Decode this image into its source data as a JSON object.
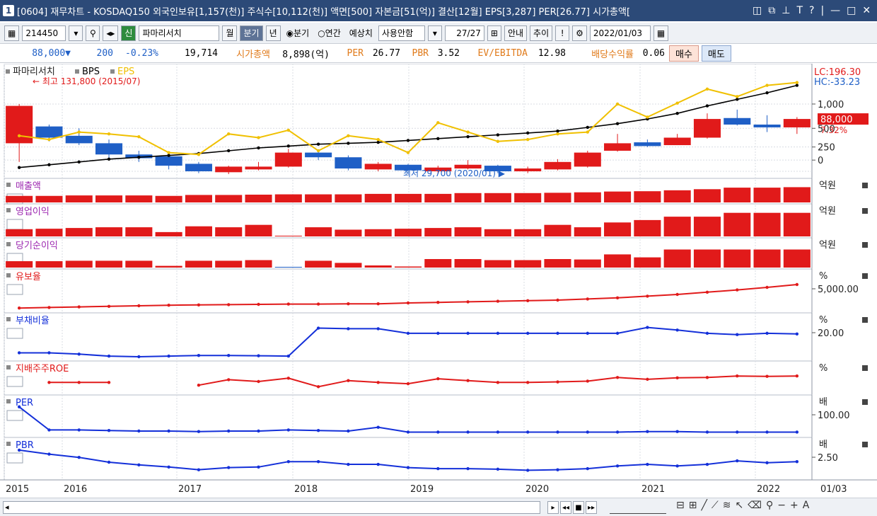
{
  "window": {
    "num": "1",
    "title": "[0604] 재무차트 - KOSDAQ150 외국인보유[1,157(천)] 주식수[10,112(천)] 액면[500] 자본금[51(억)] 결산[12월] EPS[3,287] PER[26.77] 시가총액[",
    "icons": [
      "◫",
      "⧉",
      "⊥",
      "T",
      "?",
      "|",
      "—",
      "□",
      "✕"
    ]
  },
  "toolbar": {
    "code": "214450",
    "mode": "신",
    "name": "파마리서치",
    "period_month": "월",
    "period_quarter": "분기",
    "period_year": "년",
    "radio_quarter": "◉분기",
    "radio_annual": "○연간",
    "estimate_label": "예상치",
    "estimate_value": "사용안함",
    "page": "27/27",
    "guide": "안내",
    "trend": "추이",
    "excl": "!",
    "date": "2022/01/03"
  },
  "info": {
    "price": "88,000▼",
    "change": "200",
    "change_pct": "-0.23%",
    "volume": "19,714",
    "mcap_label": "시가총액",
    "mcap": "8,898(억)",
    "per_label": "PER",
    "per": "26.77",
    "pbr_label": "PBR",
    "pbr": "3.52",
    "ev_label": "EV/EBITDA",
    "ev": "12.98",
    "div_label": "배당수익률",
    "div": "0.06",
    "buy": "매수",
    "sell": "매도"
  },
  "colors": {
    "up": "#e11a1a",
    "down": "#1f5fc6",
    "eps": "#f0c000",
    "bps": "#000000",
    "grid": "#d8dce3",
    "axis_bg": "#ffffff"
  },
  "chart_data": {
    "type": "candlestick+lines+bars",
    "x_labels": [
      "2015",
      "2016",
      "2017",
      "2018",
      "2019",
      "2020",
      "2021",
      "2022",
      "01/03"
    ],
    "main": {
      "legend": [
        "파마리서치",
        "BPS",
        "EPS"
      ],
      "high_note": "최고 131,800 (2015/07)",
      "low_note": "최저 29,700 (2020/01)",
      "lc": "LC:196.30",
      "hc": "HC:-33.23",
      "ticks": [
        "1,000",
        "500",
        "250",
        "0"
      ],
      "price_label": "88,000",
      "price_pct": "7.32%",
      "candles": [
        {
          "o": 0.3,
          "c": 0.7,
          "h": 0.72,
          "l": 0.1
        },
        {
          "o": 0.48,
          "c": 0.36,
          "h": 0.5,
          "l": 0.32
        },
        {
          "o": 0.38,
          "c": 0.3,
          "h": 0.46,
          "l": 0.28
        },
        {
          "o": 0.3,
          "c": 0.18,
          "h": 0.34,
          "l": 0.14
        },
        {
          "o": 0.18,
          "c": 0.14,
          "h": 0.22,
          "l": 0.1
        },
        {
          "o": 0.16,
          "c": 0.06,
          "h": 0.2,
          "l": 0.02
        },
        {
          "o": 0.08,
          "c": 0.0,
          "h": 0.1,
          "l": -0.02
        },
        {
          "o": -0.01,
          "c": 0.05,
          "h": 0.06,
          "l": -0.03
        },
        {
          "o": 0.02,
          "c": 0.05,
          "h": 0.1,
          "l": 0.01
        },
        {
          "o": 0.05,
          "c": 0.2,
          "h": 0.24,
          "l": 0.04
        },
        {
          "o": 0.2,
          "c": 0.15,
          "h": 0.22,
          "l": 0.12
        },
        {
          "o": 0.15,
          "c": 0.03,
          "h": 0.17,
          "l": 0.01
        },
        {
          "o": 0.02,
          "c": 0.08,
          "h": 0.1,
          "l": 0.0
        },
        {
          "o": 0.07,
          "c": 0.01,
          "h": 0.08,
          "l": -0.03
        },
        {
          "o": 0.0,
          "c": 0.04,
          "h": 0.06,
          "l": -0.03
        },
        {
          "o": 0.03,
          "c": 0.07,
          "h": 0.12,
          "l": 0.02
        },
        {
          "o": 0.06,
          "c": 0.0,
          "h": 0.07,
          "l": -0.02
        },
        {
          "o": 0.0,
          "c": 0.03,
          "h": 0.05,
          "l": -0.02
        },
        {
          "o": 0.02,
          "c": 0.1,
          "h": 0.13,
          "l": 0.01
        },
        {
          "o": 0.05,
          "c": 0.2,
          "h": 0.22,
          "l": 0.04
        },
        {
          "o": 0.22,
          "c": 0.3,
          "h": 0.4,
          "l": 0.21
        },
        {
          "o": 0.31,
          "c": 0.27,
          "h": 0.34,
          "l": 0.26
        },
        {
          "o": 0.28,
          "c": 0.36,
          "h": 0.4,
          "l": 0.28
        },
        {
          "o": 0.36,
          "c": 0.56,
          "h": 0.62,
          "l": 0.35
        },
        {
          "o": 0.57,
          "c": 0.5,
          "h": 0.66,
          "l": 0.49
        },
        {
          "o": 0.5,
          "c": 0.47,
          "h": 0.6,
          "l": 0.42
        },
        {
          "o": 0.47,
          "c": 0.56,
          "h": 0.58,
          "l": 0.4
        }
      ],
      "bps": [
        0.04,
        0.07,
        0.1,
        0.13,
        0.15,
        0.17,
        0.19,
        0.22,
        0.25,
        0.27,
        0.29,
        0.3,
        0.31,
        0.33,
        0.35,
        0.37,
        0.39,
        0.41,
        0.43,
        0.47,
        0.51,
        0.56,
        0.62,
        0.7,
        0.77,
        0.84,
        0.92
      ],
      "eps": [
        0.38,
        0.34,
        0.42,
        0.4,
        0.37,
        0.2,
        0.18,
        0.4,
        0.36,
        0.44,
        0.22,
        0.38,
        0.34,
        0.2,
        0.52,
        0.42,
        0.32,
        0.34,
        0.4,
        0.42,
        0.72,
        0.58,
        0.73,
        0.88,
        0.8,
        0.92,
        0.95
      ]
    },
    "panels": [
      {
        "name": "매출액",
        "unit": "억원",
        "type": "bar",
        "values": [
          0.42,
          0.42,
          0.45,
          0.45,
          0.45,
          0.42,
          0.48,
          0.48,
          0.5,
          0.52,
          0.52,
          0.52,
          0.55,
          0.55,
          0.55,
          0.6,
          0.6,
          0.6,
          0.62,
          0.65,
          0.7,
          0.72,
          0.78,
          0.85,
          0.95,
          0.95,
          0.98
        ]
      },
      {
        "name": "영업이익",
        "unit": "억원",
        "type": "bar",
        "values": [
          0.3,
          0.32,
          0.35,
          0.38,
          0.38,
          0.18,
          0.42,
          0.38,
          0.48,
          0.02,
          0.38,
          0.28,
          0.3,
          0.32,
          0.35,
          0.38,
          0.3,
          0.3,
          0.48,
          0.38,
          0.58,
          0.68,
          0.82,
          0.82,
          0.98,
          0.98,
          0.98
        ]
      },
      {
        "name": "당기순이익",
        "unit": "억원",
        "type": "bar",
        "values": [
          0.3,
          0.3,
          0.32,
          0.32,
          0.32,
          0.08,
          0.32,
          0.32,
          0.35,
          -0.02,
          0.32,
          0.22,
          0.1,
          0.05,
          0.4,
          0.4,
          0.35,
          0.35,
          0.4,
          0.38,
          0.62,
          0.48,
          0.85,
          0.85,
          0.85,
          0.85,
          0.85
        ]
      },
      {
        "name": "유보율",
        "unit": "%",
        "tick": "5,000.00",
        "type": "line",
        "color": "#e11a1a",
        "values": [
          0.02,
          0.04,
          0.06,
          0.08,
          0.1,
          0.12,
          0.13,
          0.14,
          0.15,
          0.16,
          0.16,
          0.17,
          0.17,
          0.2,
          0.22,
          0.24,
          0.26,
          0.28,
          0.3,
          0.34,
          0.38,
          0.44,
          0.5,
          0.58,
          0.66,
          0.75,
          0.85
        ]
      },
      {
        "name": "부채비율",
        "unit": "%",
        "tick": "20.00",
        "type": "line",
        "color": "#1430d9",
        "values": [
          0.12,
          0.12,
          0.08,
          0.02,
          0.0,
          0.02,
          0.04,
          0.04,
          0.03,
          0.02,
          0.88,
          0.86,
          0.86,
          0.72,
          0.72,
          0.72,
          0.72,
          0.72,
          0.72,
          0.72,
          0.72,
          0.9,
          0.82,
          0.72,
          0.68,
          0.72,
          0.7
        ]
      },
      {
        "name": "지배주주ROE",
        "unit": "%",
        "type": "line",
        "color": "#e11a1a",
        "values": [
          null,
          0.45,
          0.45,
          0.45,
          null,
          null,
          0.3,
          0.6,
          0.5,
          0.68,
          0.22,
          0.55,
          0.45,
          0.38,
          0.65,
          0.55,
          0.45,
          0.45,
          0.48,
          0.52,
          0.72,
          0.62,
          0.7,
          0.72,
          0.8,
          0.78,
          0.8
        ]
      },
      {
        "name": "PER",
        "unit": "배",
        "tick": "100.00",
        "type": "line",
        "color": "#1430d9",
        "values": [
          0.98,
          0.12,
          0.12,
          0.1,
          0.08,
          0.08,
          0.06,
          0.08,
          0.08,
          0.12,
          0.1,
          0.08,
          0.22,
          0.04,
          0.04,
          0.04,
          0.04,
          0.04,
          0.04,
          0.04,
          0.04,
          0.06,
          0.06,
          0.04,
          0.04,
          0.04,
          0.04
        ]
      },
      {
        "name": "PBR",
        "unit": "배",
        "tick": "2.50",
        "type": "line",
        "color": "#1430d9",
        "values": [
          0.95,
          0.8,
          0.68,
          0.5,
          0.4,
          0.32,
          0.22,
          0.3,
          0.32,
          0.52,
          0.52,
          0.42,
          0.42,
          0.3,
          0.26,
          0.26,
          0.24,
          0.2,
          0.22,
          0.26,
          0.36,
          0.42,
          0.36,
          0.42,
          0.55,
          0.48,
          0.52
        ]
      }
    ]
  }
}
